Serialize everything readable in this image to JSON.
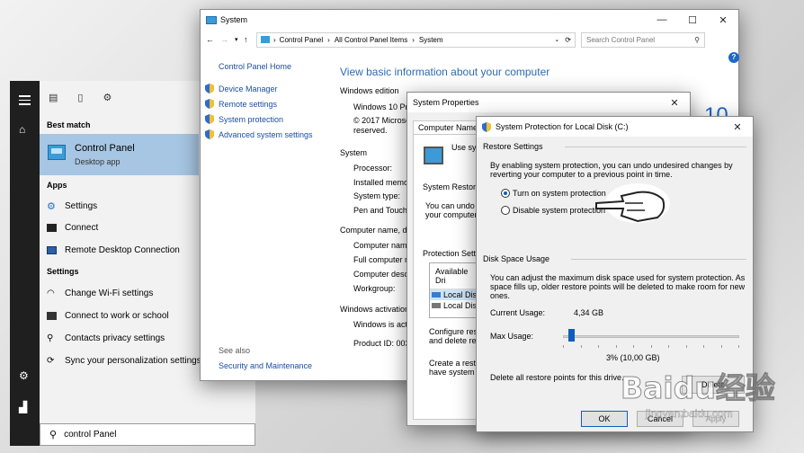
{
  "start_menu": {
    "best_match_heading": "Best match",
    "best_match_title": "Control Panel",
    "best_match_sub": "Desktop app",
    "apps_heading": "Apps",
    "apps": [
      "Settings",
      "Connect",
      "Remote Desktop Connection"
    ],
    "settings_heading": "Settings",
    "settings": [
      "Change Wi-Fi settings",
      "Connect to work or school",
      "Contacts privacy settings",
      "Sync your personalization settings"
    ],
    "search_value": "control Panel"
  },
  "system_window": {
    "title": "System",
    "breadcrumb": [
      "Control Panel",
      "All Control Panel Items",
      "System"
    ],
    "search_placeholder": "Search Control Panel",
    "side_home": "Control Panel Home",
    "side_links": [
      "Device Manager",
      "Remote settings",
      "System protection",
      "Advanced system settings"
    ],
    "see_also": "See also",
    "security_link": "Security and Maintenance",
    "heading": "View basic information about your computer",
    "windows_edition_heading": "Windows edition",
    "edition_line1": "Windows 10 Pro",
    "edition_line2": "© 2017 Microsoft",
    "edition_line3": "reserved.",
    "system_heading": "System",
    "system_labels": [
      "Processor:",
      "Installed memor",
      "System type:",
      "Pen and Touch:"
    ],
    "computer_heading": "Computer name, do",
    "computer_labels": [
      "Computer name",
      "Full computer nam",
      "Computer descr",
      "Workgroup:"
    ],
    "activation_heading": "Windows activation",
    "activation_line": "Windows is activ",
    "product_id": "Product ID: 0033",
    "logo_text": "10"
  },
  "sysprops": {
    "title": "System Properties",
    "tab": "Computer Name",
    "use_text": "Use sy",
    "restore_heading": "System Restore",
    "restore_text1": "You can undo s",
    "restore_text2": "your computer t",
    "protection_heading": "Protection Settin",
    "table_header": "Available Dri",
    "drives": [
      "Local Dis",
      "Local Dis"
    ],
    "configure_text1": "Configure resto",
    "configure_text2": "and delete rest",
    "create_text1": "Create a resto",
    "create_text2": "have system p"
  },
  "protection_dialog": {
    "title": "System Protection for Local Disk (C:)",
    "restore_heading": "Restore Settings",
    "restore_desc1": "By enabling system protection, you can undo undesired changes by",
    "restore_desc2": "reverting your computer to a previous point in time.",
    "radio_on": "Turn on system protection",
    "radio_off": "Disable system protection",
    "disk_heading": "Disk Space Usage",
    "disk_desc1": "You can adjust the maximum disk space used for system protection. As",
    "disk_desc2": "space fills up, older restore points will be deleted to make room for new",
    "disk_desc3": "ones.",
    "current_usage_label": "Current Usage:",
    "current_usage_value": "4,34 GB",
    "max_usage_label": "Max Usage:",
    "max_usage_percent": 3,
    "max_usage_value": "3% (10,00 GB)",
    "delete_text": "Delete all restore points for this drive.",
    "delete_btn": "Delete",
    "ok": "OK",
    "cancel": "Cancel",
    "apply": "Apply"
  },
  "watermark": {
    "text": "Baidu经验",
    "url": "jingyan.baidu.com"
  }
}
